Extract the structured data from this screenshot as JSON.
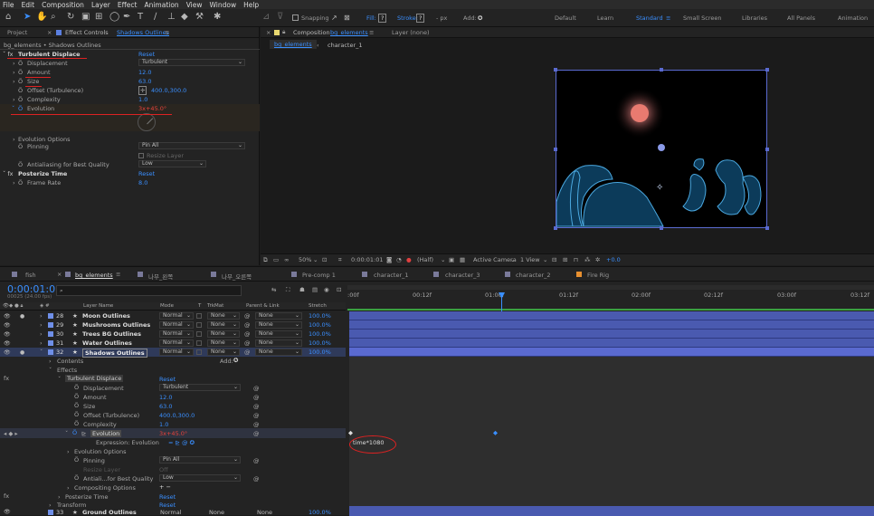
{
  "menu": [
    "File",
    "Edit",
    "Composition",
    "Layer",
    "Effect",
    "Animation",
    "View",
    "Window",
    "Help"
  ],
  "toolbar": {
    "snapping": "Snapping",
    "fill": "Fill:",
    "fill_q": "?",
    "stroke": "Stroke:",
    "stroke_q": "?",
    "px": "- px",
    "add": "Add:"
  },
  "workspaces": [
    "Default",
    "Learn",
    "Standard",
    "Small Screen",
    "Libraries",
    "All Panels",
    "Animation"
  ],
  "ec": {
    "tab_project": "Project",
    "tab_effect": "Effect Controls",
    "tab_effect_layer": "Shadows Outlines",
    "breadcrumb": "bg_elements • Shadows Outlines",
    "rows": [
      {
        "label": "Turbulent Displace",
        "value": "Reset",
        "kind": "fx"
      },
      {
        "label": "Displacement",
        "value": "Turbulent",
        "kind": "dd"
      },
      {
        "label": "Amount",
        "value": "12.0",
        "kind": "num"
      },
      {
        "label": "Size",
        "value": "63.0",
        "kind": "num"
      },
      {
        "label": "Offset (Turbulence)",
        "value": "400.0,300.0",
        "kind": "num"
      },
      {
        "label": "Complexity",
        "value": "1.0",
        "kind": "num"
      },
      {
        "label": "Evolution",
        "value": "3x+45.0°",
        "kind": "red"
      },
      {
        "label": "Evolution Options",
        "value": "",
        "kind": "group"
      },
      {
        "label": "Pinning",
        "value": "Pin All",
        "kind": "dd"
      },
      {
        "label": "Resize Layer",
        "value": "",
        "kind": "cb"
      },
      {
        "label": "Antialiasing for Best Quality",
        "value": "Low",
        "kind": "dd"
      },
      {
        "label": "Posterize Time",
        "value": "Reset",
        "kind": "fx"
      },
      {
        "label": "Frame Rate",
        "value": "8.0",
        "kind": "num"
      }
    ]
  },
  "comp": {
    "tab": "Composition",
    "tab_name": "bg_elements",
    "layer": "Layer (none)",
    "breadcrumb1": "bg_elements",
    "breadcrumb2": "character_1",
    "zoom": "50%",
    "time": "0:00:01:01",
    "res": "(Half)",
    "camera": "Active Camera",
    "view": "1 View",
    "exposure": "+0.0"
  },
  "timeline": {
    "tabs": [
      "fish",
      "bg_elements",
      "나무_왼쪽",
      "나무_오른쪽",
      "Pre-comp 1",
      "character_1",
      "character_3",
      "character_2",
      "Fire Rig"
    ],
    "timecode": "0:00:01:01",
    "fps": "00025 (24.00 fps)",
    "columns": {
      "name": "Layer Name",
      "mode": "Mode",
      "t": "T",
      "trkmat": "TrkMat",
      "parent": "Parent & Link",
      "stretch": "Stretch"
    },
    "ruler": [
      ":00f",
      "00:12f",
      "01:00f",
      "01:12f",
      "02:00f",
      "02:12f",
      "03:00f",
      "03:12f"
    ],
    "layers": [
      {
        "num": "28",
        "name": "Moon Outlines",
        "mode": "Normal",
        "trk": "None",
        "parent": "None",
        "stretch": "100.0%"
      },
      {
        "num": "29",
        "name": "Mushrooms Outlines",
        "mode": "Normal",
        "trk": "None",
        "parent": "None",
        "stretch": "100.0%"
      },
      {
        "num": "30",
        "name": "Trees BG Outlines",
        "mode": "Normal",
        "trk": "None",
        "parent": "None",
        "stretch": "100.0%"
      },
      {
        "num": "31",
        "name": "Water Outlines",
        "mode": "Normal",
        "trk": "None",
        "parent": "None",
        "stretch": "100.0%"
      },
      {
        "num": "32",
        "name": "Shadows Outlines",
        "mode": "Normal",
        "trk": "None",
        "parent": "None",
        "stretch": "100.0%"
      }
    ],
    "contents": "Contents",
    "add": "Add:",
    "effects": "Effects",
    "fx_name": "Turbulent Displace",
    "reset": "Reset",
    "props": [
      {
        "label": "Displacement",
        "value": "Turbulent",
        "kind": "dd"
      },
      {
        "label": "Amount",
        "value": "12.0",
        "kind": "num"
      },
      {
        "label": "Size",
        "value": "63.0",
        "kind": "num"
      },
      {
        "label": "Offset (Turbulence)",
        "value": "400.0,300.0",
        "kind": "num"
      },
      {
        "label": "Complexity",
        "value": "1.0",
        "kind": "num"
      }
    ],
    "evolution": "Evolution",
    "evolution_val": "3x+45.0°",
    "expr_label": "Expression: Evolution",
    "expr": "time*1080",
    "evo_options": "Evolution Options",
    "pinning": "Pinning",
    "pinning_val": "Pin All",
    "resize": "Resize Layer",
    "resize_val": "Off",
    "antialias": "Antiali...for Best Quality",
    "antialias_val": "Low",
    "compositing": "Compositing Options",
    "posterize": "Posterize Time",
    "transform": "Transform",
    "next_layer_num": "33",
    "next_layer": "Ground Outlines",
    "next_mode": "Normal",
    "next_trk": "None",
    "next_parent": "None",
    "next_stretch": "100.0%"
  }
}
